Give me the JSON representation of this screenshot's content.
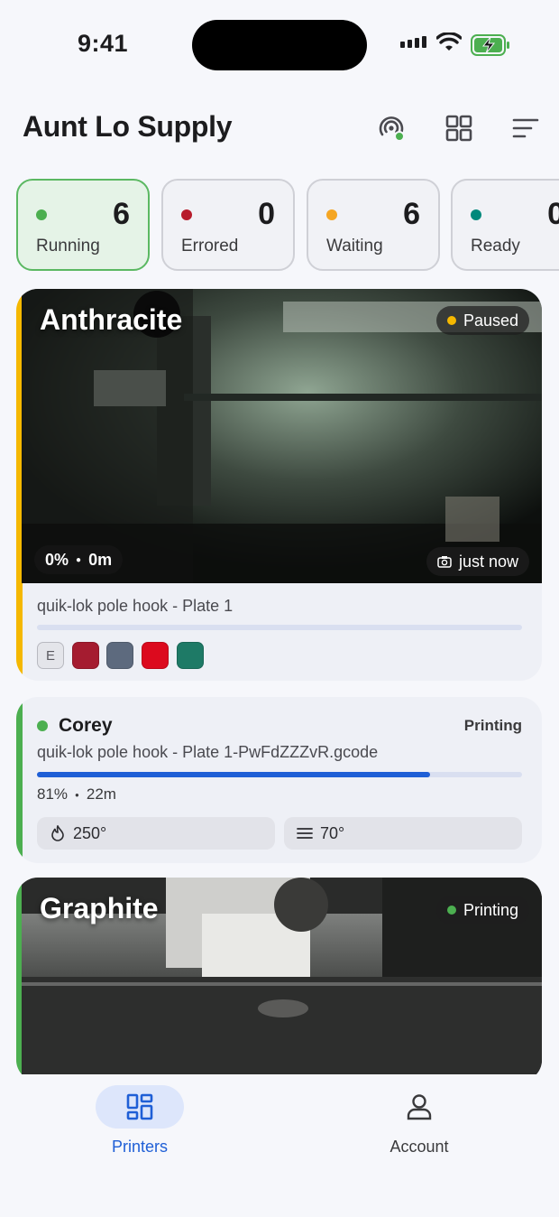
{
  "status_bar": {
    "time": "9:41"
  },
  "header": {
    "title": "Aunt Lo Supply"
  },
  "filters": [
    {
      "label": "Running",
      "count": "6",
      "color": "#4caf50",
      "active": true
    },
    {
      "label": "Errored",
      "count": "0",
      "color": "#b71c2c",
      "active": false
    },
    {
      "label": "Waiting",
      "count": "6",
      "color": "#f5a623",
      "active": false
    },
    {
      "label": "Ready",
      "count": "0",
      "color": "#00897b",
      "active": false
    }
  ],
  "printers": [
    {
      "name": "Anthracite",
      "status": "Paused",
      "status_color": "#f5b800",
      "progress_text": "0%",
      "time_left": "0m",
      "snapshot": "just now",
      "job": "quik-lok pole hook - Plate 1",
      "progress": 0,
      "extruder_label": "E",
      "filaments": [
        "#a51c30",
        "#5d6a7e",
        "#dc0a1e",
        "#1e7a66"
      ]
    },
    {
      "name": "Corey",
      "status": "Printing",
      "status_color": "#4caf50",
      "job": "quik-lok pole hook - Plate 1-PwFdZZZvR.gcode",
      "progress_text": "81%",
      "time_left": "22m",
      "progress": 0.81,
      "nozzle_temp": "250°",
      "bed_temp": "70°"
    },
    {
      "name": "Graphite",
      "status": "Printing",
      "status_color": "#4caf50"
    }
  ],
  "tabs": [
    {
      "label": "Printers",
      "icon": "grid-icon",
      "active": true
    },
    {
      "label": "Account",
      "icon": "person-icon",
      "active": false
    }
  ],
  "colors": {
    "accent": "#1f5fd6",
    "running": "#4caf50",
    "paused": "#f5b800"
  }
}
